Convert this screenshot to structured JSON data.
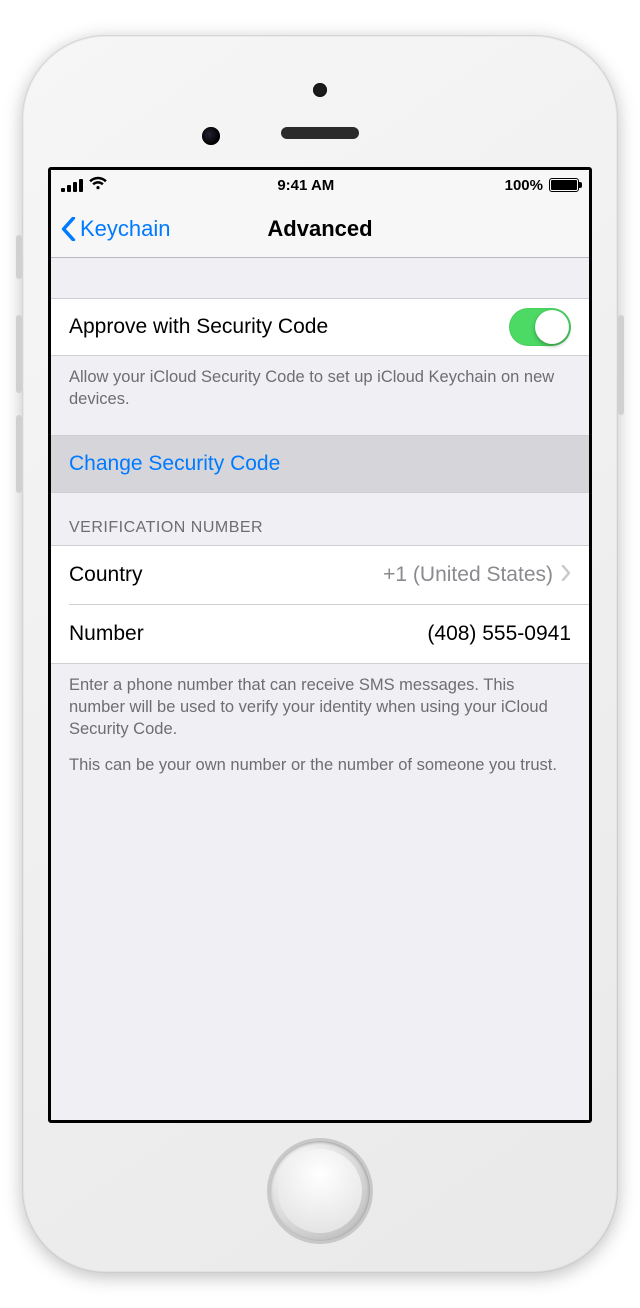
{
  "status": {
    "time": "9:41 AM",
    "battery_pct": "100%"
  },
  "nav": {
    "back_label": "Keychain",
    "title": "Advanced"
  },
  "approve": {
    "label": "Approve with Security Code",
    "footer": "Allow your iCloud Security Code to set up iCloud Keychain on new devices."
  },
  "change": {
    "label": "Change Security Code"
  },
  "verification": {
    "header": "VERIFICATION NUMBER",
    "country_label": "Country",
    "country_value": "+1 (United States)",
    "number_label": "Number",
    "number_value": "(408) 555-0941",
    "footer1": "Enter a phone number that can receive SMS messages. This number will be used to verify your identity when using your iCloud Security Code.",
    "footer2": "This can be your own number or the number of someone you trust."
  }
}
